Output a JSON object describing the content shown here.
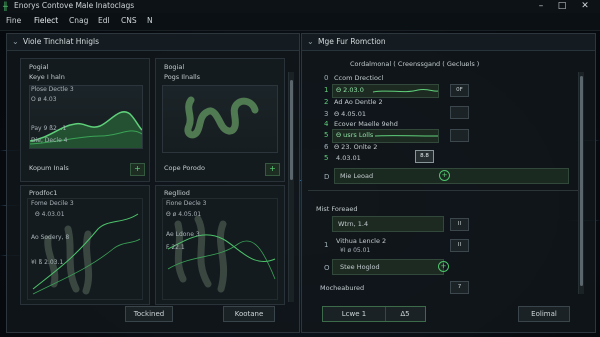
{
  "app": {
    "title": "Enorys Contove Male Inatoclags"
  },
  "menu": [
    "Fine",
    "Fielect",
    "Cnag",
    "Edl",
    "CNS",
    "N"
  ],
  "left_panel": {
    "title": "Viole Tinchlat Hnigls",
    "cards": [
      {
        "title": "Pogial",
        "subtitle": "Keye I haln",
        "line1": "Plose Dectle 3",
        "line2": "O ø 4.03",
        "line3": "Pay 9 ß2 ..1",
        "line4": "Die, Decle 4",
        "footer": "Kopum Inals"
      },
      {
        "title": "Bogial",
        "subtitle": "Pogs Ilnalls",
        "footer": "Cope Porodo"
      },
      {
        "title": "Prodfoc1",
        "subtitle": "Fome Decile 3",
        "line1": "Θ 4.03.01",
        "line2": "Ao Sodery, 8",
        "line3": "¥I ß 2.03.1"
      },
      {
        "title": "Reglliod",
        "subtitle": "Fione Decle 3",
        "line1": "Θ ø 4.05.01",
        "line2": "Ae Ldone 3",
        "line3": "F 22.1"
      }
    ],
    "buttons": {
      "left": "Tockined",
      "right": "Kootane"
    }
  },
  "right_panel": {
    "title": "Mge Fur Romction",
    "dropdown": "Cordalmonal ( Creenssgand ( Geclunls )",
    "rows": [
      {
        "n": "0",
        "label": "Ccom Drectiocl"
      },
      {
        "n": "1",
        "label": "Θ 2.03.0",
        "btn": "0F"
      },
      {
        "n": "2",
        "label": "Ad Ao Dentle 2"
      },
      {
        "n": "3",
        "label": "Θ 4.05.01"
      },
      {
        "n": "4",
        "label": "Ecover Maelle 9ehd"
      },
      {
        "n": "5",
        "label": "Θ usrs Lolls"
      },
      {
        "n": "6",
        "label": "Θ 23. Onlte 2"
      },
      {
        "n": "5",
        "label": "4.03.01",
        "btn": "8.8"
      }
    ],
    "mie": {
      "n": "D",
      "label": "Mie Leoad"
    },
    "section2_title": "Mist Foreaed",
    "fields": [
      {
        "n": "",
        "label": "Wtrn, 1.4",
        "btn": "II"
      },
      {
        "n": "1",
        "label": "Vithua Lencle 2",
        "sub": "¥I ø 05.01",
        "btn": "II"
      },
      {
        "n": "O",
        "label": "Stee Hoglod"
      }
    ],
    "footer_label": "Mocheabured",
    "footer_btn": "7",
    "buttons": {
      "left": "Lcwe 1",
      "mid": "Δ5",
      "right": "Eolimal"
    }
  },
  "colors": {
    "accent": "#4cc46a",
    "bg": "#070b10",
    "panel": "#10161a"
  }
}
